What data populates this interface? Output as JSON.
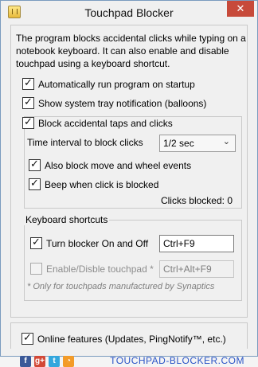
{
  "window": {
    "title": "Touchpad Blocker",
    "close_glyph": "✕"
  },
  "description": "The program blocks accidental clicks while typing on a notebook keyboard. It can also enable and disable touchpad using a keyboard shortcut.",
  "options": {
    "autostart": {
      "label": "Automatically run program on startup",
      "checked": true
    },
    "tray": {
      "label": "Show system tray notification (balloons)",
      "checked": true
    },
    "block_taps": {
      "label": "Block accidental taps and clicks",
      "checked": true
    },
    "interval_label": "Time interval to block clicks",
    "interval_value": "1/2 sec",
    "block_move": {
      "label": "Also block move and wheel events",
      "checked": true
    },
    "beep": {
      "label": "Beep when click is blocked",
      "checked": true
    },
    "clicks_blocked": "Clicks blocked: 0"
  },
  "shortcuts": {
    "title": "Keyboard shortcuts",
    "turn_on_off": {
      "label": "Turn blocker On and Off",
      "checked": true,
      "value": "Ctrl+F9"
    },
    "enable_disable": {
      "label": "Enable/Disble touchpad *",
      "checked": false,
      "value": "Ctrl+Alt+F9"
    },
    "footnote": "* Only for touchpads manufactured by Synaptics"
  },
  "online": {
    "label": "Online features (Updates, PingNotify™, etc.)",
    "checked": true
  },
  "social": [
    {
      "name": "facebook-icon",
      "glyph": "f",
      "color": "#3b5998"
    },
    {
      "name": "google-plus-icon",
      "glyph": "g+",
      "color": "#d34836"
    },
    {
      "name": "twitter-icon",
      "glyph": "t",
      "color": "#33a7dd"
    },
    {
      "name": "rss-icon",
      "glyph": "◔",
      "color": "#f39b28"
    }
  ],
  "site_link": "TOUCHPAD-BLOCKER.COM"
}
